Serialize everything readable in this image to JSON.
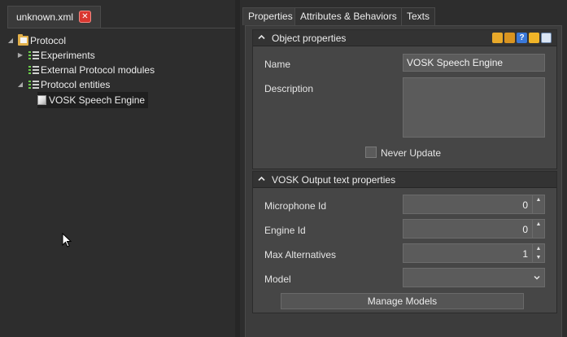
{
  "file_tab": {
    "label": "unknown.xml"
  },
  "tree": {
    "root": "Protocol",
    "items": [
      {
        "label": "Experiments"
      },
      {
        "label": "External Protocol modules"
      },
      {
        "label": "Protocol entities"
      },
      {
        "label": "VOSK Speech Engine"
      }
    ]
  },
  "tabs": [
    {
      "label": "Properties"
    },
    {
      "label": "Attributes & Behaviors"
    },
    {
      "label": "Texts"
    }
  ],
  "object_properties": {
    "title": "Object properties",
    "name_label": "Name",
    "name_value": "VOSK Speech Engine",
    "description_label": "Description",
    "description_value": "",
    "never_update_label": "Never Update"
  },
  "vosk_properties": {
    "title": "VOSK Output text properties",
    "microphone_id_label": "Microphone Id",
    "microphone_id_value": "0",
    "engine_id_label": "Engine Id",
    "engine_id_value": "0",
    "max_alternatives_label": "Max Alternatives",
    "max_alternatives_value": "1",
    "model_label": "Model",
    "model_value": "",
    "manage_models_label": "Manage Models"
  },
  "icons": {
    "close": "close-icon",
    "root": "folder-icon",
    "list": "list-icon",
    "entity": "cube-icon",
    "section_toggle": "chevron-up-icon",
    "header_tools": [
      "key-icon",
      "key-alt-icon",
      "help-icon",
      "bolt-icon",
      "document-icon"
    ]
  },
  "colors": {
    "background": "#2d2d2d",
    "panel": "#3c3c3c",
    "section": "#464646",
    "input": "#5b5b5b",
    "close_red": "#d9362f"
  }
}
